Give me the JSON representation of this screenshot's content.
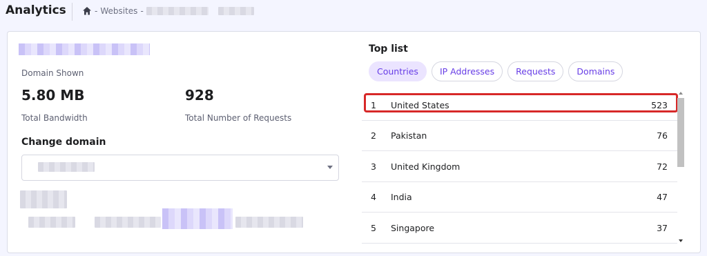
{
  "header": {
    "title": "Analytics",
    "breadcrumb": {
      "separator1": "-",
      "websites": "Websites",
      "separator2": "-"
    }
  },
  "overview": {
    "domain_label": "Domain Shown",
    "bandwidth_value": "5.80 MB",
    "bandwidth_label": "Total Bandwidth",
    "requests_value": "928",
    "requests_label": "Total Number of Requests",
    "change_domain_title": "Change domain"
  },
  "top_list": {
    "title": "Top list",
    "tabs": [
      {
        "label": "Countries",
        "active": true
      },
      {
        "label": "IP Addresses",
        "active": false
      },
      {
        "label": "Requests",
        "active": false
      },
      {
        "label": "Domains",
        "active": false
      }
    ],
    "rows": [
      {
        "rank": "1",
        "name": "United States",
        "count": "523"
      },
      {
        "rank": "2",
        "name": "Pakistan",
        "count": "76"
      },
      {
        "rank": "3",
        "name": "United Kingdom",
        "count": "72"
      },
      {
        "rank": "4",
        "name": "India",
        "count": "47"
      },
      {
        "rank": "5",
        "name": "Singapore",
        "count": "37"
      }
    ]
  },
  "colors": {
    "accent": "#673de6",
    "active_tab_bg": "#ebe4ff",
    "highlight": "#d72828"
  },
  "icons": {
    "home": "home-icon",
    "dropdown": "chevron-down-icon"
  }
}
